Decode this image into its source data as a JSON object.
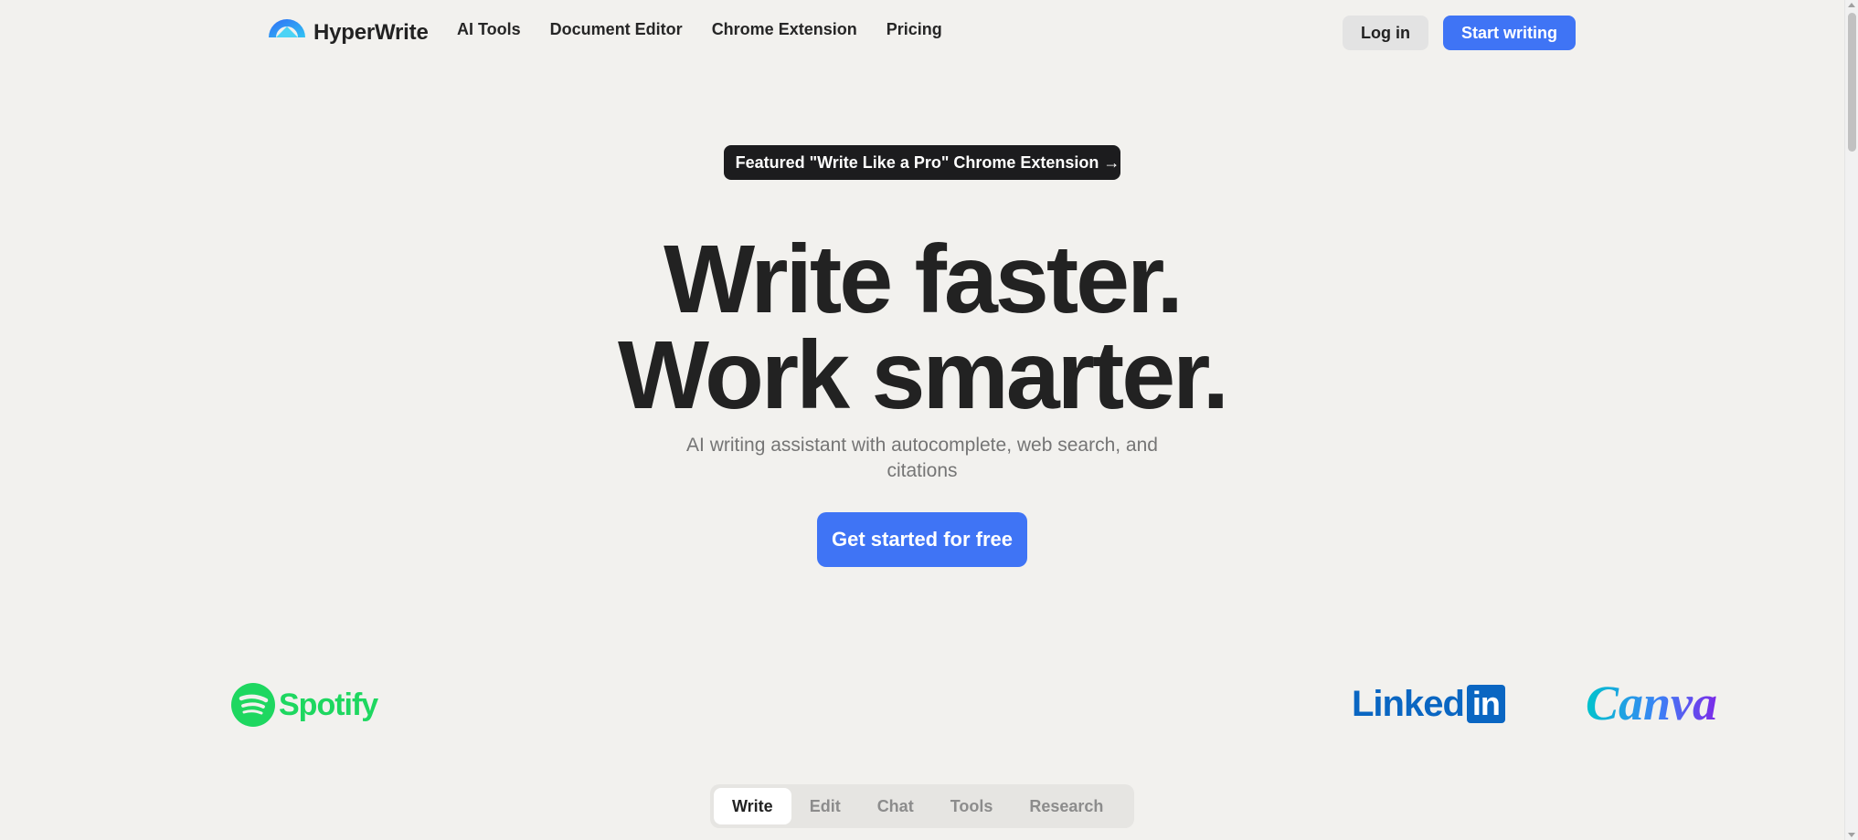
{
  "nav": {
    "brand": "HyperWrite",
    "links": [
      "AI Tools",
      "Document Editor",
      "Chrome Extension",
      "Pricing"
    ],
    "login_label": "Log in",
    "start_label": "Start writing"
  },
  "hero": {
    "badge": "Featured \"Write Like a Pro\" Chrome Extension →",
    "headline_line1": "Write faster.",
    "headline_line2": "Work smarter.",
    "subtitle": "AI writing assistant with autocomplete, web search, and citations",
    "cta_label": "Get started for free"
  },
  "logos": {
    "spotify": "Spotify",
    "linkedin_word": "Linked",
    "linkedin_box": "in",
    "canva": "Canva"
  },
  "tabs": [
    "Write",
    "Edit",
    "Chat",
    "Tools",
    "Research"
  ],
  "active_tab": "Write",
  "colors": {
    "background": "#f2f1ee",
    "accent": "#3f74f5",
    "spotify": "#1ed760",
    "linkedin": "#0a66c2"
  }
}
